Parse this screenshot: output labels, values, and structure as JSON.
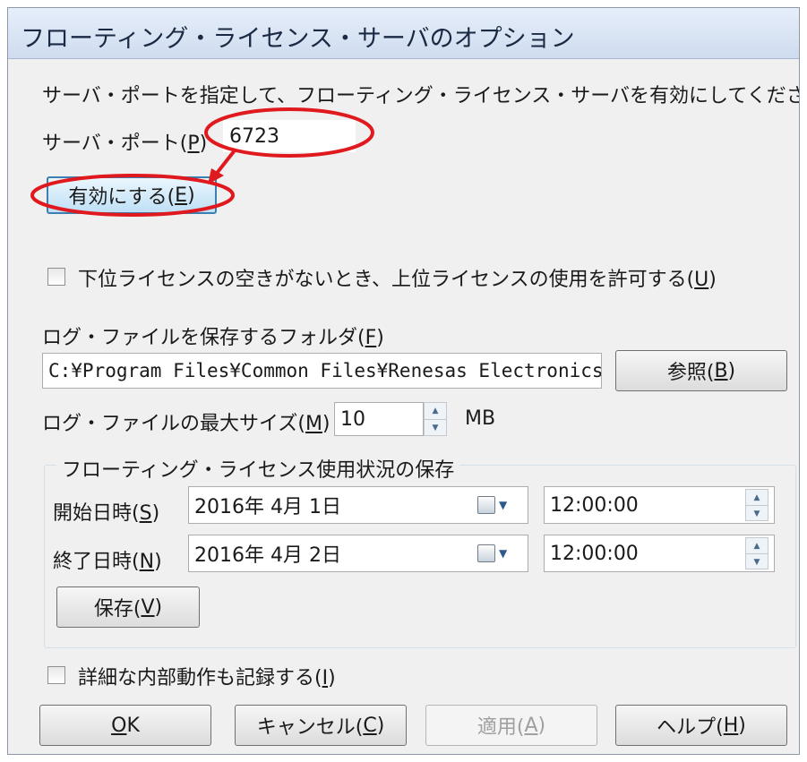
{
  "window": {
    "title": "フローティング・ライセンス・サーバのオプション"
  },
  "intro_text": "サーバ・ポートを指定して、フローティング・ライセンス・サーバを有効にしてください。",
  "server_port": {
    "label": "サーバ・ポート(",
    "mnemonic": "P",
    "label_end": ")",
    "value": "6723"
  },
  "enable_button": {
    "label": "有効にする(",
    "mnemonic": "E",
    "label_end": ")"
  },
  "allow_upper_license": {
    "label": "下位ライセンスの空きがないとき、上位ライセンスの使用を許可する(",
    "mnemonic": "U",
    "label_end": ")",
    "checked": false
  },
  "log_folder": {
    "label": "ログ・ファイルを保存するフォルダ(",
    "mnemonic": "F",
    "label_end": ")",
    "value": "C:¥Program Files¥Common Files¥Renesas Electronics"
  },
  "browse_button": {
    "label": "参照(",
    "mnemonic": "B",
    "label_end": ")"
  },
  "log_max_size": {
    "label": "ログ・ファイルの最大サイズ(",
    "mnemonic": "M",
    "label_end": ")",
    "value": "10",
    "unit": "MB"
  },
  "usage_group": {
    "title": "フローティング・ライセンス使用状況の保存",
    "start": {
      "label": "開始日時(",
      "mnemonic": "S",
      "label_end": ")",
      "date": "2016年  4月  1日",
      "time": "12:00:00"
    },
    "end": {
      "label": "終了日時(",
      "mnemonic": "N",
      "label_end": ")",
      "date": "2016年  4月  2日",
      "time": "12:00:00"
    },
    "save_button": {
      "label": "保存(",
      "mnemonic": "V",
      "label_end": ")"
    }
  },
  "detail_log": {
    "label": "詳細な内部動作も記録する(",
    "mnemonic": "I",
    "label_end": ")",
    "checked": false
  },
  "buttons": {
    "ok": {
      "mnemonic": "O",
      "label_end": "K"
    },
    "cancel": {
      "label": "キャンセル(",
      "mnemonic": "C",
      "label_end": ")"
    },
    "apply": {
      "label": "適用(",
      "mnemonic": "A",
      "label_end": ")"
    },
    "help": {
      "label": "ヘルプ(",
      "mnemonic": "H",
      "label_end": ")"
    }
  },
  "colors": {
    "annotation": "#e0191e",
    "button_focus": "#3c7fb1",
    "titlebar": "#cfdcef"
  }
}
